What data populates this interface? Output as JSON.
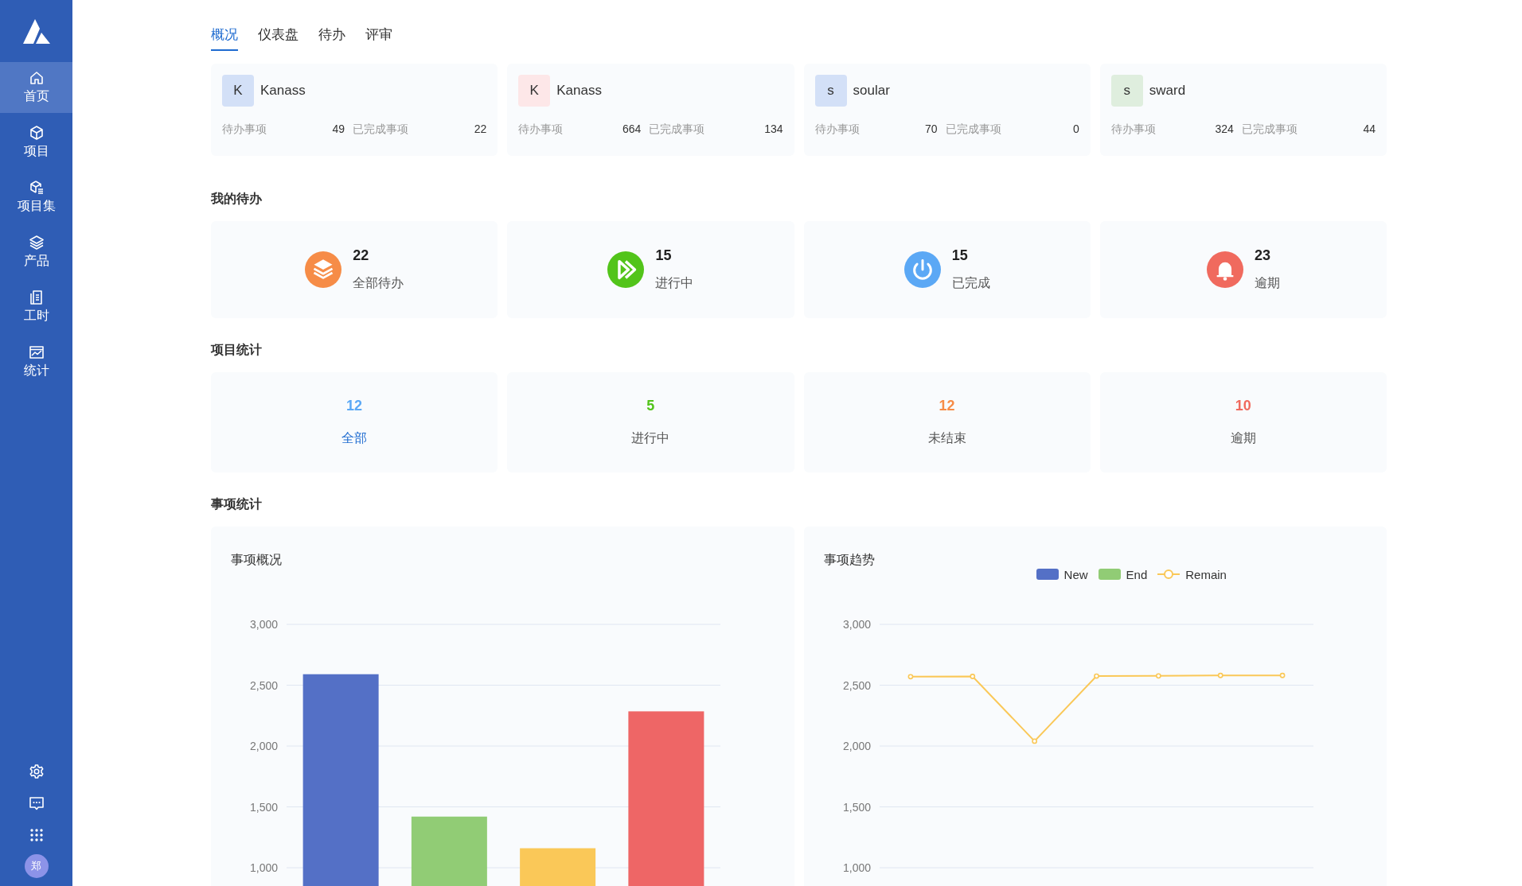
{
  "sidebar": {
    "items": [
      {
        "label": "首页",
        "selected": true
      },
      {
        "label": "项目",
        "selected": false
      },
      {
        "label": "项目集",
        "selected": false
      },
      {
        "label": "产品",
        "selected": false
      },
      {
        "label": "工时",
        "selected": false
      },
      {
        "label": "统计",
        "selected": false
      }
    ],
    "avatar": "郑"
  },
  "tabs": [
    {
      "label": "概况",
      "selected": true
    },
    {
      "label": "仪表盘",
      "selected": false
    },
    {
      "label": "待办",
      "selected": false
    },
    {
      "label": "评审",
      "selected": false
    }
  ],
  "projects": [
    {
      "initial": "K",
      "name": "Kanass",
      "color": "#d3e0f7",
      "todo_label": "待办事项",
      "todo": "49",
      "done_label": "已完成事项",
      "done": "22"
    },
    {
      "initial": "K",
      "name": "Kanass",
      "color": "#fde7e8",
      "todo_label": "待办事项",
      "todo": "664",
      "done_label": "已完成事项",
      "done": "134"
    },
    {
      "initial": "s",
      "name": "soular",
      "color": "#d3e0f7",
      "todo_label": "待办事项",
      "todo": "70",
      "done_label": "已完成事项",
      "done": "0"
    },
    {
      "initial": "s",
      "name": "sward",
      "color": "#dfeede",
      "todo_label": "待办事项",
      "todo": "324",
      "done_label": "已完成事项",
      "done": "44"
    }
  ],
  "my_todo": {
    "title": "我的待办",
    "items": [
      {
        "kind": "layers",
        "count": "22",
        "label": "全部待办",
        "color": "#f68c47"
      },
      {
        "kind": "play",
        "count": "15",
        "label": "进行中",
        "color": "#52c41a"
      },
      {
        "kind": "power",
        "count": "15",
        "label": "已完成",
        "color": "#5ba8f5"
      },
      {
        "kind": "bell",
        "count": "23",
        "label": "逾期",
        "color": "#f06a5e"
      }
    ]
  },
  "project_stats": {
    "title": "项目统计",
    "items": [
      {
        "count": "12",
        "label": "全部",
        "color": "#5ba8f5",
        "selected": true
      },
      {
        "count": "5",
        "label": "进行中",
        "color": "#52c41a",
        "selected": false
      },
      {
        "count": "12",
        "label": "未结束",
        "color": "#f68c47",
        "selected": false
      },
      {
        "count": "10",
        "label": "逾期",
        "color": "#f06a5e",
        "selected": false
      }
    ]
  },
  "issue_stats": {
    "title": "事项统计",
    "panels": [
      {
        "title": "事项概况",
        "chart_data": {
          "type": "bar",
          "grid": true,
          "ylim": [
            1000,
            3000
          ],
          "yticks": [
            {
              "value": 1000,
              "label": "1,000"
            },
            {
              "value": 1500,
              "label": "1,500"
            },
            {
              "value": 2000,
              "label": "2,000"
            },
            {
              "value": 2500,
              "label": "2,500"
            },
            {
              "value": 3000,
              "label": "3,000"
            }
          ],
          "series": [
            {
              "color": "#5470c6",
              "values": [
                2590,
                null,
                null,
                null
              ]
            },
            {
              "color": "#91cc75",
              "values": [
                null,
                1420,
                null,
                null
              ]
            },
            {
              "color": "#fac858",
              "values": [
                null,
                null,
                1160,
                null
              ]
            },
            {
              "color": "#ee6666",
              "values": [
                null,
                null,
                null,
                2285
              ]
            }
          ]
        }
      },
      {
        "title": "事项趋势",
        "chart_data": {
          "type": "line",
          "grid": true,
          "ylim": [
            1000,
            3000
          ],
          "yticks": [
            {
              "value": 1000,
              "label": "1,000"
            },
            {
              "value": 1500,
              "label": "1,500"
            },
            {
              "value": 2000,
              "label": "2,000"
            },
            {
              "value": 2500,
              "label": "2,500"
            },
            {
              "value": 3000,
              "label": "3,000"
            }
          ],
          "series": [
            {
              "name": "New",
              "color": "#5470c6",
              "values": [
                null,
                null,
                null,
                null,
                null,
                null,
                null
              ]
            },
            {
              "name": "End",
              "color": "#91cc75",
              "values": [
                null,
                null,
                null,
                null,
                null,
                null,
                null
              ]
            },
            {
              "name": "Remain",
              "color": "#fac858",
              "marker": true,
              "values": [
                2570,
                2572,
                2040,
                2575,
                2576,
                2580,
                2580
              ]
            }
          ]
        }
      }
    ]
  }
}
